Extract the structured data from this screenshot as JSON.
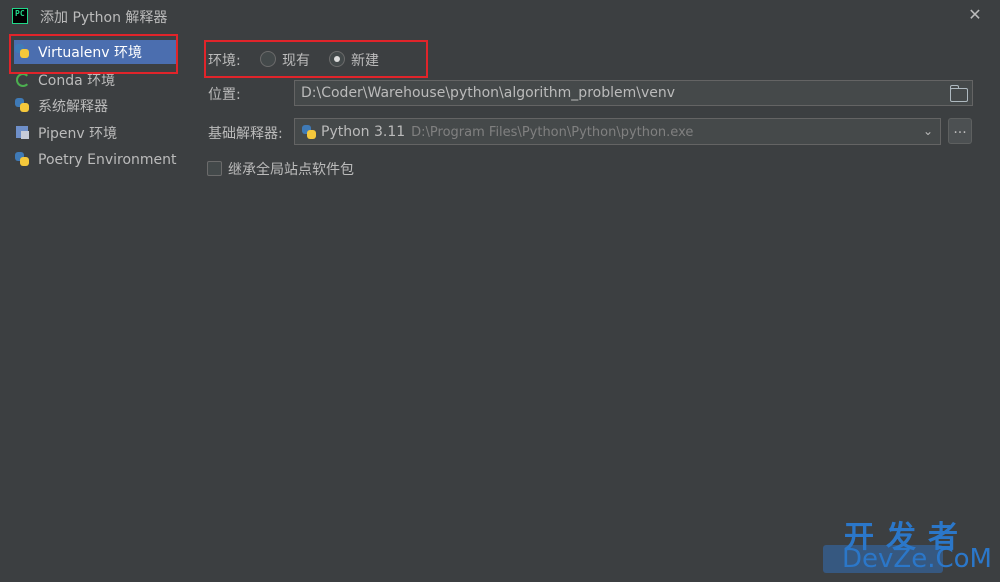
{
  "window": {
    "title": "添加 Python 解释器",
    "close_label": "✕"
  },
  "sidebar": {
    "items": [
      {
        "label": "Virtualenv 环境",
        "icon": "python-icon",
        "selected": true
      },
      {
        "label": "Conda 环境",
        "icon": "conda-icon",
        "selected": false
      },
      {
        "label": "系统解释器",
        "icon": "python-icon",
        "selected": false
      },
      {
        "label": "Pipenv 环境",
        "icon": "pipenv-icon",
        "selected": false
      },
      {
        "label": "Poetry Environment",
        "icon": "python-icon",
        "selected": false
      }
    ]
  },
  "form": {
    "env_label": "环境:",
    "env_options": [
      {
        "label": "现有",
        "checked": false
      },
      {
        "label": "新建",
        "checked": true
      }
    ],
    "location_label": "位置:",
    "location_value": "D:\\Coder\\Warehouse\\python\\algorithm_problem\\venv",
    "base_label": "基础解释器:",
    "base_value": "Python 3.11",
    "base_path": "D:\\Program Files\\Python\\Python\\python.exe",
    "browse_label": "...",
    "inherit_label": "继承全局站点软件包",
    "inherit_checked": false
  },
  "watermark": {
    "cn": "开发者",
    "en": "DevZe.CoM"
  },
  "colors": {
    "background": "#3c3f41",
    "selection": "#4b6eaf",
    "highlight_box": "#e1242a",
    "watermark": "#2b77c9"
  }
}
